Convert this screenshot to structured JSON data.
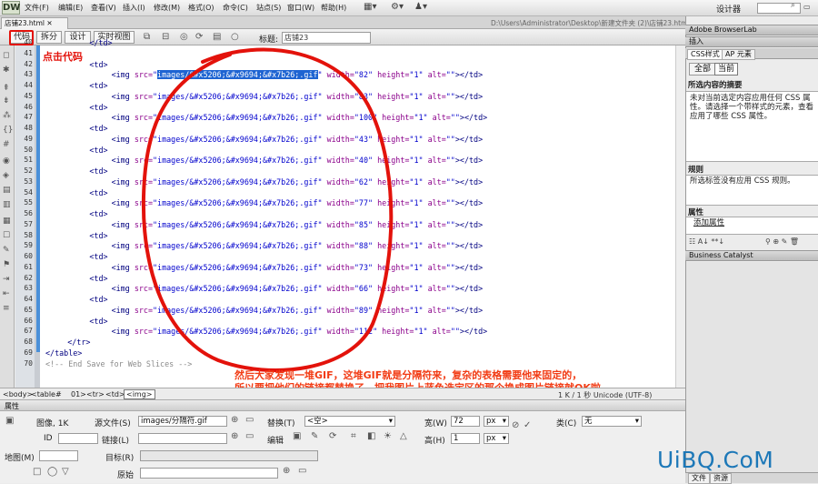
{
  "app": {
    "logo": "DW",
    "designer": "设计器",
    "search_icon": "search-icon"
  },
  "menu": [
    "文件(F)",
    "编辑(E)",
    "查看(V)",
    "插入(I)",
    "修改(M)",
    "格式(O)",
    "命令(C)",
    "站点(S)",
    "窗口(W)",
    "帮助(H)"
  ],
  "document": {
    "tab": "店铺23.html",
    "path": "D:\\Users\\Administrator\\Desktop\\新建文件夹 (2)\\店铺23.html",
    "views": {
      "code": "代码",
      "split": "拆分",
      "design": "设计",
      "live": "实时视图"
    },
    "title_label": "标题:",
    "title_value": "店铺23"
  },
  "annotations": {
    "click_code": "点击代码",
    "note_line1": "然后大家发现一堆GIF，这堆GIF就是分隔符来，复杂的表格需要他来固定的，",
    "note_line2": "所以要把他们的链接都替换了。把我图片上蓝色选定区的那个换成图片链接就OK啦。"
  },
  "code": {
    "line_numbers": [
      "40",
      "41",
      "42",
      "43",
      "44",
      "45",
      "46",
      "47",
      "48",
      "49",
      "50",
      "51",
      "52",
      "53",
      "54",
      "55",
      "56",
      "57",
      "58",
      "59",
      "60",
      "61",
      "62",
      "63",
      "64",
      "65",
      "66",
      "67",
      "68",
      "69",
      "70"
    ],
    "img_lines": [
      {
        "src_selected": "images/&#x5206;&#x9694;&#x7b26;.gif",
        "width": "82"
      },
      {
        "src": "images/&#x5206;&#x9694;&#x7b26;.gif",
        "width": "83"
      },
      {
        "src": "images/&#x5206;&#x9694;&#x7b26;.gif",
        "width": "100"
      },
      {
        "src": "images/&#x5206;&#x9694;&#x7b26;.gif",
        "width": "43"
      },
      {
        "src": "images/&#x5206;&#x9694;&#x7b26;.gif",
        "width": "40"
      },
      {
        "src": "images/&#x5206;&#x9694;&#x7b26;.gif",
        "width": "62"
      },
      {
        "src": "images/&#x5206;&#x9694;&#x7b26;.gif",
        "width": "77"
      },
      {
        "src": "images/&#x5206;&#x9694;&#x7b26;.gif",
        "width": "85"
      },
      {
        "src": "images/&#x5206;&#x9694;&#x7b26;.gif",
        "width": "88"
      },
      {
        "src": "images/&#x5206;&#x9694;&#x7b26;.gif",
        "width": "73"
      },
      {
        "src": "images/&#x5206;&#x9694;&#x7b26;.gif",
        "width": "66"
      },
      {
        "src": "images/&#x5206;&#x9694;&#x7b26;.gif",
        "width": "89"
      },
      {
        "src": "images/&#x5206;&#x9694;&#x7b26;.gif",
        "width": "112"
      }
    ],
    "td_open": "<td>",
    "td_close": "</td>",
    "tr_close": "</tr>",
    "table_close": "</table>",
    "comment": "<!-- End Save for Web Slices -->"
  },
  "status": {
    "crumbs": [
      "<body>",
      "<table#",
      "01>",
      "<tr>",
      "<td>",
      "<img>"
    ],
    "right": "1 K / 1 秒 Unicode (UTF-8)"
  },
  "properties": {
    "header": "属性",
    "kind": "图像, 1K",
    "src_label": "源文件(S)",
    "src_value": "images/分隔符.gif",
    "alt_label": "替换(T)",
    "alt_value": "<空>",
    "width_label": "宽(W)",
    "width_value": "72",
    "height_label": "高(H)",
    "height_value": "1",
    "unit": "px",
    "class_label": "类(C)",
    "class_value": "无",
    "id_label": "ID",
    "link_label": "链接(L)",
    "edit_label": "编辑",
    "map_label": "地图(M)",
    "target_label": "目标(R)",
    "original_label": "原始"
  },
  "right_panel": {
    "browserlab": "Adobe BrowserLab",
    "insert": "插入",
    "tab_css": "CSS样式",
    "tab_ap": "AP 元素",
    "btn_all": "全部",
    "btn_current": "当前",
    "summary_title": "所选内容的摘要",
    "summary_text": "未对当前选定内容应用任何 CSS 属性。请选择一个带样式的元素，查看应用了哪些 CSS 属性。",
    "rules_title": "规则",
    "rules_text": "所选标签没有应用 CSS 规则。",
    "props_title": "属性",
    "add_prop": "添加属性",
    "business": "Business Catalyst",
    "bottom_tab1": "文件",
    "bottom_tab2": "资源"
  },
  "watermark": "UiBQ.CoM"
}
